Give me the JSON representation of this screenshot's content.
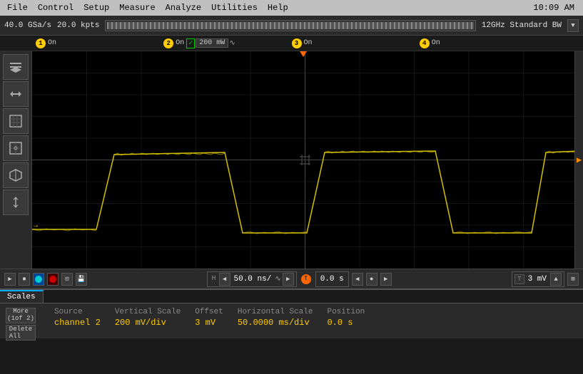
{
  "menubar": {
    "items": [
      "File",
      "Control",
      "Setup",
      "Measure",
      "Analyze",
      "Utilities",
      "Help"
    ],
    "time": "10:09 AM"
  },
  "toolbar": {
    "sample_rate": "40.0 GSa/s",
    "mem_depth": "20.0 kpts",
    "bw_label": "12GHz Standard BW"
  },
  "channels": [
    {
      "num": "1",
      "label": "On",
      "color": "#ffcc00"
    },
    {
      "num": "2",
      "label": "On",
      "value": "200 mW",
      "color": "#ffcc00"
    },
    {
      "num": "3",
      "label": "On",
      "color": "#ffcc00"
    },
    {
      "num": "4",
      "label": "On",
      "color": "#ffcc00"
    }
  ],
  "bottom_toolbar": {
    "time_div": "50.0 ns/",
    "time_pos": "0.0 s",
    "trigger_label": "T",
    "trigger_value": "3 mV"
  },
  "scales": {
    "tab": "Scales",
    "source_label": "Source",
    "source_value": "channel 2",
    "vertical_scale_label": "Vertical Scale",
    "vertical_scale_value": "200 mV/div",
    "offset_label": "Offset",
    "offset_value": "3 mV",
    "horizontal_scale_label": "Horizontal Scale",
    "horizontal_scale_value": "50.0000 ms/div",
    "position_label": "Position",
    "position_value": "0.0 s"
  },
  "sidebar_buttons": [
    {
      "icon": "↕",
      "name": "vertical-scale-btn"
    },
    {
      "icon": "↔",
      "name": "horizontal-scale-btn"
    },
    {
      "icon": "⊞",
      "name": "grid-btn"
    },
    {
      "icon": "⊡",
      "name": "cursor-btn"
    },
    {
      "icon": "↑↓",
      "name": "trigger-btn"
    },
    {
      "icon": "⊕",
      "name": "zoom-btn"
    }
  ],
  "more_btn": "More\n(1of 2)",
  "delete_all_btn": "Delete\nAll"
}
